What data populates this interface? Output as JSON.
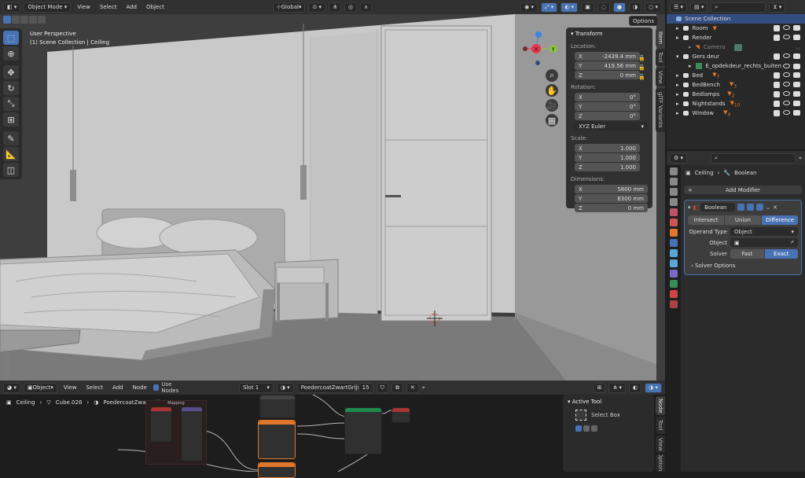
{
  "viewport_header": {
    "mode": "Object Mode",
    "menus": [
      "View",
      "Select",
      "Add",
      "Object"
    ],
    "transform_orientation": "Global",
    "options": "Options"
  },
  "viewport": {
    "perspective": "User Perspective",
    "collection": "(1) Scene Collection | Ceiling",
    "tabs": [
      "Item",
      "Tool",
      "View",
      "glTF Variants"
    ]
  },
  "transform": {
    "title": "Transform",
    "location_label": "Location:",
    "location": {
      "x": "-2439.4 mm",
      "y": "419.56 mm",
      "z": "0 mm"
    },
    "rotation_label": "Rotation:",
    "rotation": {
      "x": "0°",
      "y": "0°",
      "z": "0°"
    },
    "rotation_mode": "XYZ Euler",
    "scale_label": "Scale:",
    "scale": {
      "x": "1.000",
      "y": "1.000",
      "z": "1.000"
    },
    "dimensions_label": "Dimensions:",
    "dimensions": {
      "x": "5800 mm",
      "y": "6300 mm",
      "z": "0 mm"
    },
    "axis": {
      "x": "X",
      "y": "Y",
      "z": "Z"
    }
  },
  "outliner": {
    "root": "Scene Collection",
    "items": [
      {
        "name": "Room",
        "indent": 1
      },
      {
        "name": "Render",
        "indent": 1
      },
      {
        "name": "Camera",
        "indent": 2
      },
      {
        "name": "Gers deur",
        "indent": 1
      },
      {
        "name": "E_opdekdeur_rechts_buiten",
        "indent": 2
      },
      {
        "name": "Bed",
        "indent": 1,
        "badge": "7"
      },
      {
        "name": "BedBench",
        "indent": 1,
        "badge": "3"
      },
      {
        "name": "Bedlamps",
        "indent": 1,
        "badge": "2"
      },
      {
        "name": "Nightstands",
        "indent": 1,
        "badge": "10"
      },
      {
        "name": "Window",
        "indent": 1,
        "badge": "4"
      }
    ]
  },
  "properties": {
    "breadcrumb_object": "Ceiling",
    "breadcrumb_modifier": "Boolean",
    "add_modifier": "Add Modifier",
    "modifier_name": "Boolean",
    "operations": [
      "Intersect",
      "Union",
      "Difference"
    ],
    "active_operation": "Difference",
    "operand_type_label": "Operand Type",
    "operand_type": "Object",
    "object_label": "Object",
    "solver_label": "Solver",
    "solvers": [
      "Fast",
      "Exact"
    ],
    "active_solver": "Exact",
    "solver_options": "Solver Options"
  },
  "node_editor": {
    "editor_type": "Object",
    "menus": [
      "View",
      "Select",
      "Add",
      "Node"
    ],
    "use_nodes": "Use Nodes",
    "slot": "Slot 1",
    "material": "PoedercoatZwartGrijs",
    "users": "15",
    "breadcrumb": [
      "Ceiling",
      "Cube.026",
      "PoedercoatZwartGrijs"
    ],
    "frame_label": "Mapping"
  },
  "active_tool": {
    "title": "Active Tool",
    "tool": "Select Box",
    "tabs": [
      "Node",
      "Tool",
      "View",
      "Options"
    ]
  },
  "colors": {
    "accent": "#4772b3",
    "axis_x": "#e8344e",
    "axis_y": "#8bc53f",
    "axis_z": "#3a86e8",
    "node_orange": "#e0762c",
    "node_green": "#1e8a4c"
  }
}
